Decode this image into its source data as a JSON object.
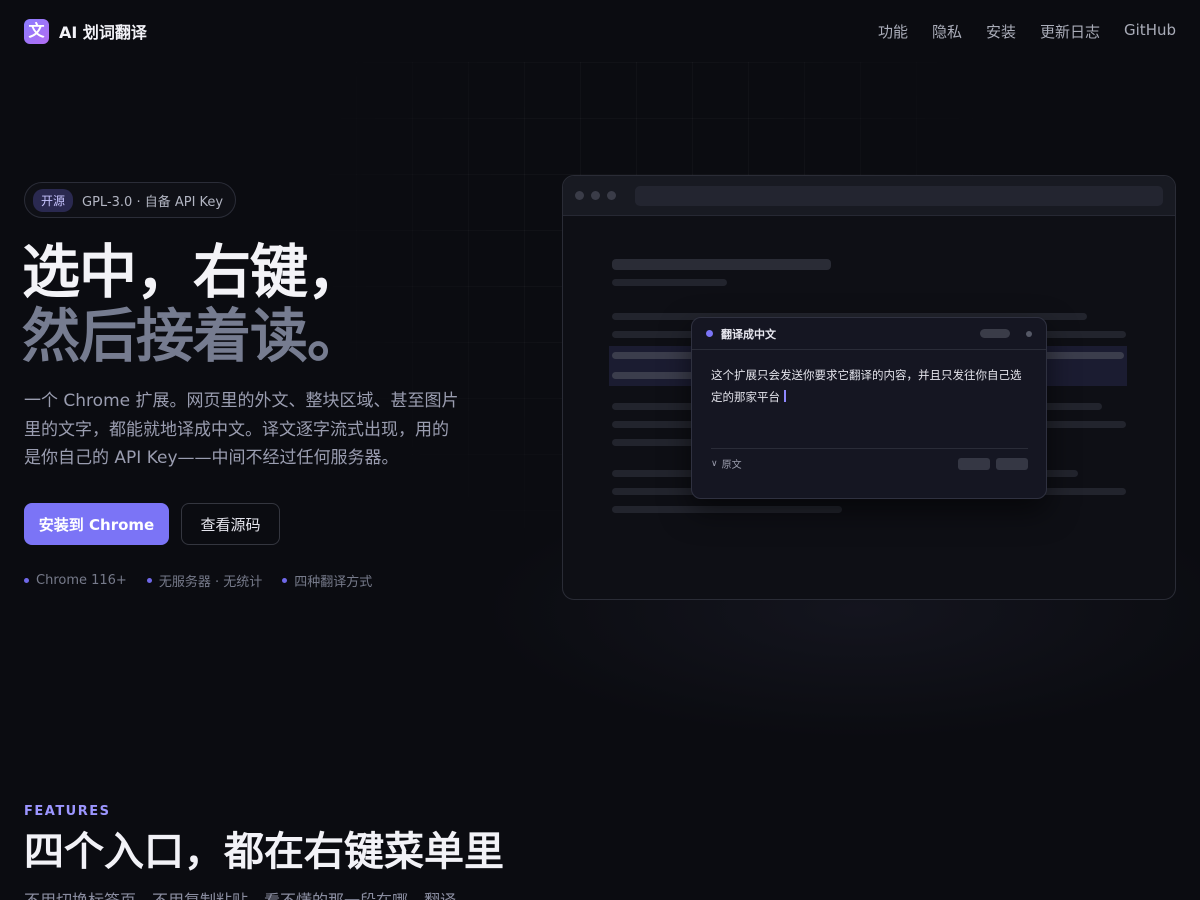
{
  "nav": {
    "brand_logo": "文",
    "brand_name": "AI 划词翻译",
    "links": [
      "功能",
      "隐私",
      "安装",
      "更新日志",
      "GitHub"
    ]
  },
  "hero": {
    "badge_tag": "开源",
    "badge_text": "GPL-3.0 · 自备 API Key",
    "title_line1": "选中，右键，",
    "title_line2": "然后接着读。",
    "description": "一个 Chrome 扩展。网页里的外文、整块区域、甚至图片里的文字，都能就地译成中文。译文逐字流式出现，用的是你自己的 API Key——中间不经过任何服务器。",
    "primary_button": "安装到 Chrome",
    "secondary_button": "查看源码",
    "meta": [
      "Chrome 116+",
      "无服务器 · 无统计",
      "四种翻译方式"
    ]
  },
  "mockup": {
    "popup_title": "翻译成中文",
    "popup_text": "这个扩展只会发送你要求它翻译的内容，并且只发往你自己选定的那家平台",
    "original_label": "原文"
  },
  "features": {
    "label": "FEATURES",
    "title": "四个入口，都在右键菜单里",
    "description": "不用切换标签页，不用复制粘贴，看不懂的那一段在哪，翻译"
  },
  "colors": {
    "background": "#0b0c11",
    "accent": "#7b74f6",
    "accent_text": "#9c96ff"
  }
}
